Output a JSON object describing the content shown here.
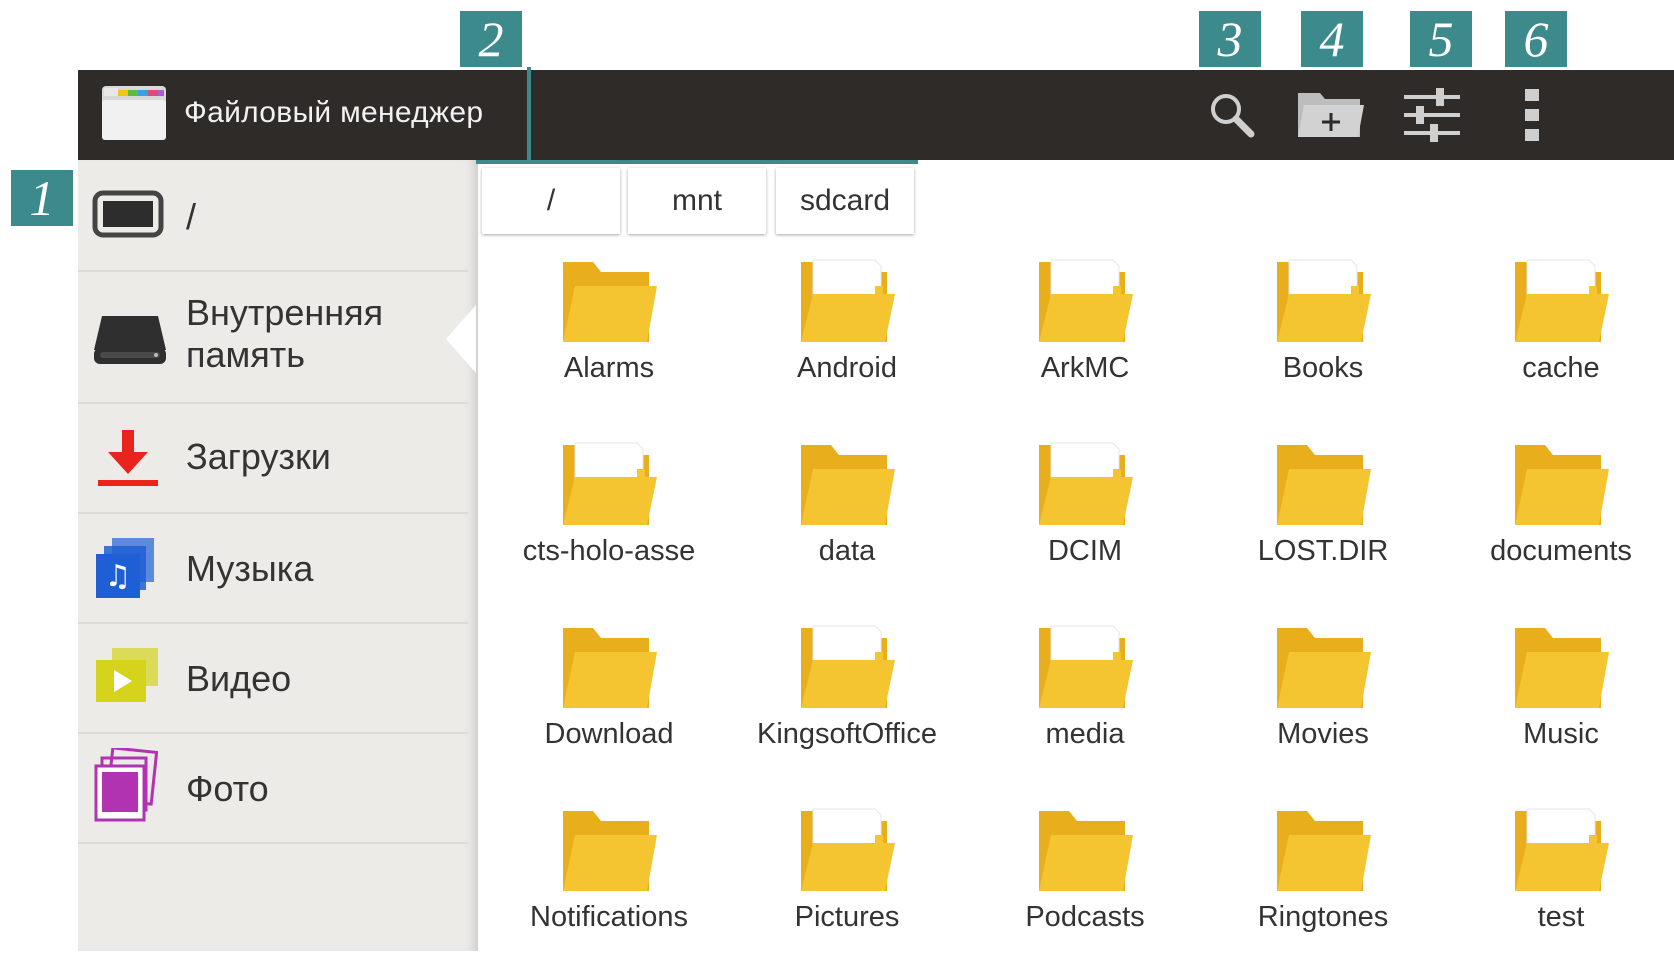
{
  "app": {
    "title": "Файловый менеджер"
  },
  "markers": [
    "1",
    "2",
    "3",
    "4",
    "5",
    "6"
  ],
  "actions": [
    {
      "name": "search-icon"
    },
    {
      "name": "new-folder-icon"
    },
    {
      "name": "sliders-icon"
    },
    {
      "name": "overflow-menu-icon"
    }
  ],
  "sidebar": {
    "items": [
      {
        "label": "/",
        "icon": "tablet-icon"
      },
      {
        "label": "Внутренняя память",
        "icon": "drive-icon"
      },
      {
        "label": "Загрузки",
        "icon": "download-icon"
      },
      {
        "label": "Музыка",
        "icon": "music-icon"
      },
      {
        "label": "Видео",
        "icon": "video-icon"
      },
      {
        "label": "Фото",
        "icon": "photo-icon"
      }
    ]
  },
  "breadcrumb": [
    "/",
    "mnt",
    "sdcard"
  ],
  "folders": [
    {
      "name": "Alarms",
      "doc": false
    },
    {
      "name": "Android",
      "doc": true
    },
    {
      "name": "ArkMC",
      "doc": true
    },
    {
      "name": "Books",
      "doc": true
    },
    {
      "name": "cache",
      "doc": true
    },
    {
      "name": "cts-holo-asse",
      "doc": true
    },
    {
      "name": "data",
      "doc": false
    },
    {
      "name": "DCIM",
      "doc": true
    },
    {
      "name": "LOST.DIR",
      "doc": false
    },
    {
      "name": "documents",
      "doc": false
    },
    {
      "name": "Download",
      "doc": false
    },
    {
      "name": "KingsoftOffice",
      "doc": true
    },
    {
      "name": "media",
      "doc": true
    },
    {
      "name": "Movies",
      "doc": false
    },
    {
      "name": "Music",
      "doc": false
    },
    {
      "name": "Notifications",
      "doc": false
    },
    {
      "name": "Pictures",
      "doc": true
    },
    {
      "name": "Podcasts",
      "doc": false
    },
    {
      "name": "Ringtones",
      "doc": false
    },
    {
      "name": "test",
      "doc": true
    }
  ],
  "colors": {
    "accent": "#3d8a8d",
    "actionbar": "#2e2b29",
    "sidebar": "#ecebe7",
    "folder": "#f5c431"
  }
}
